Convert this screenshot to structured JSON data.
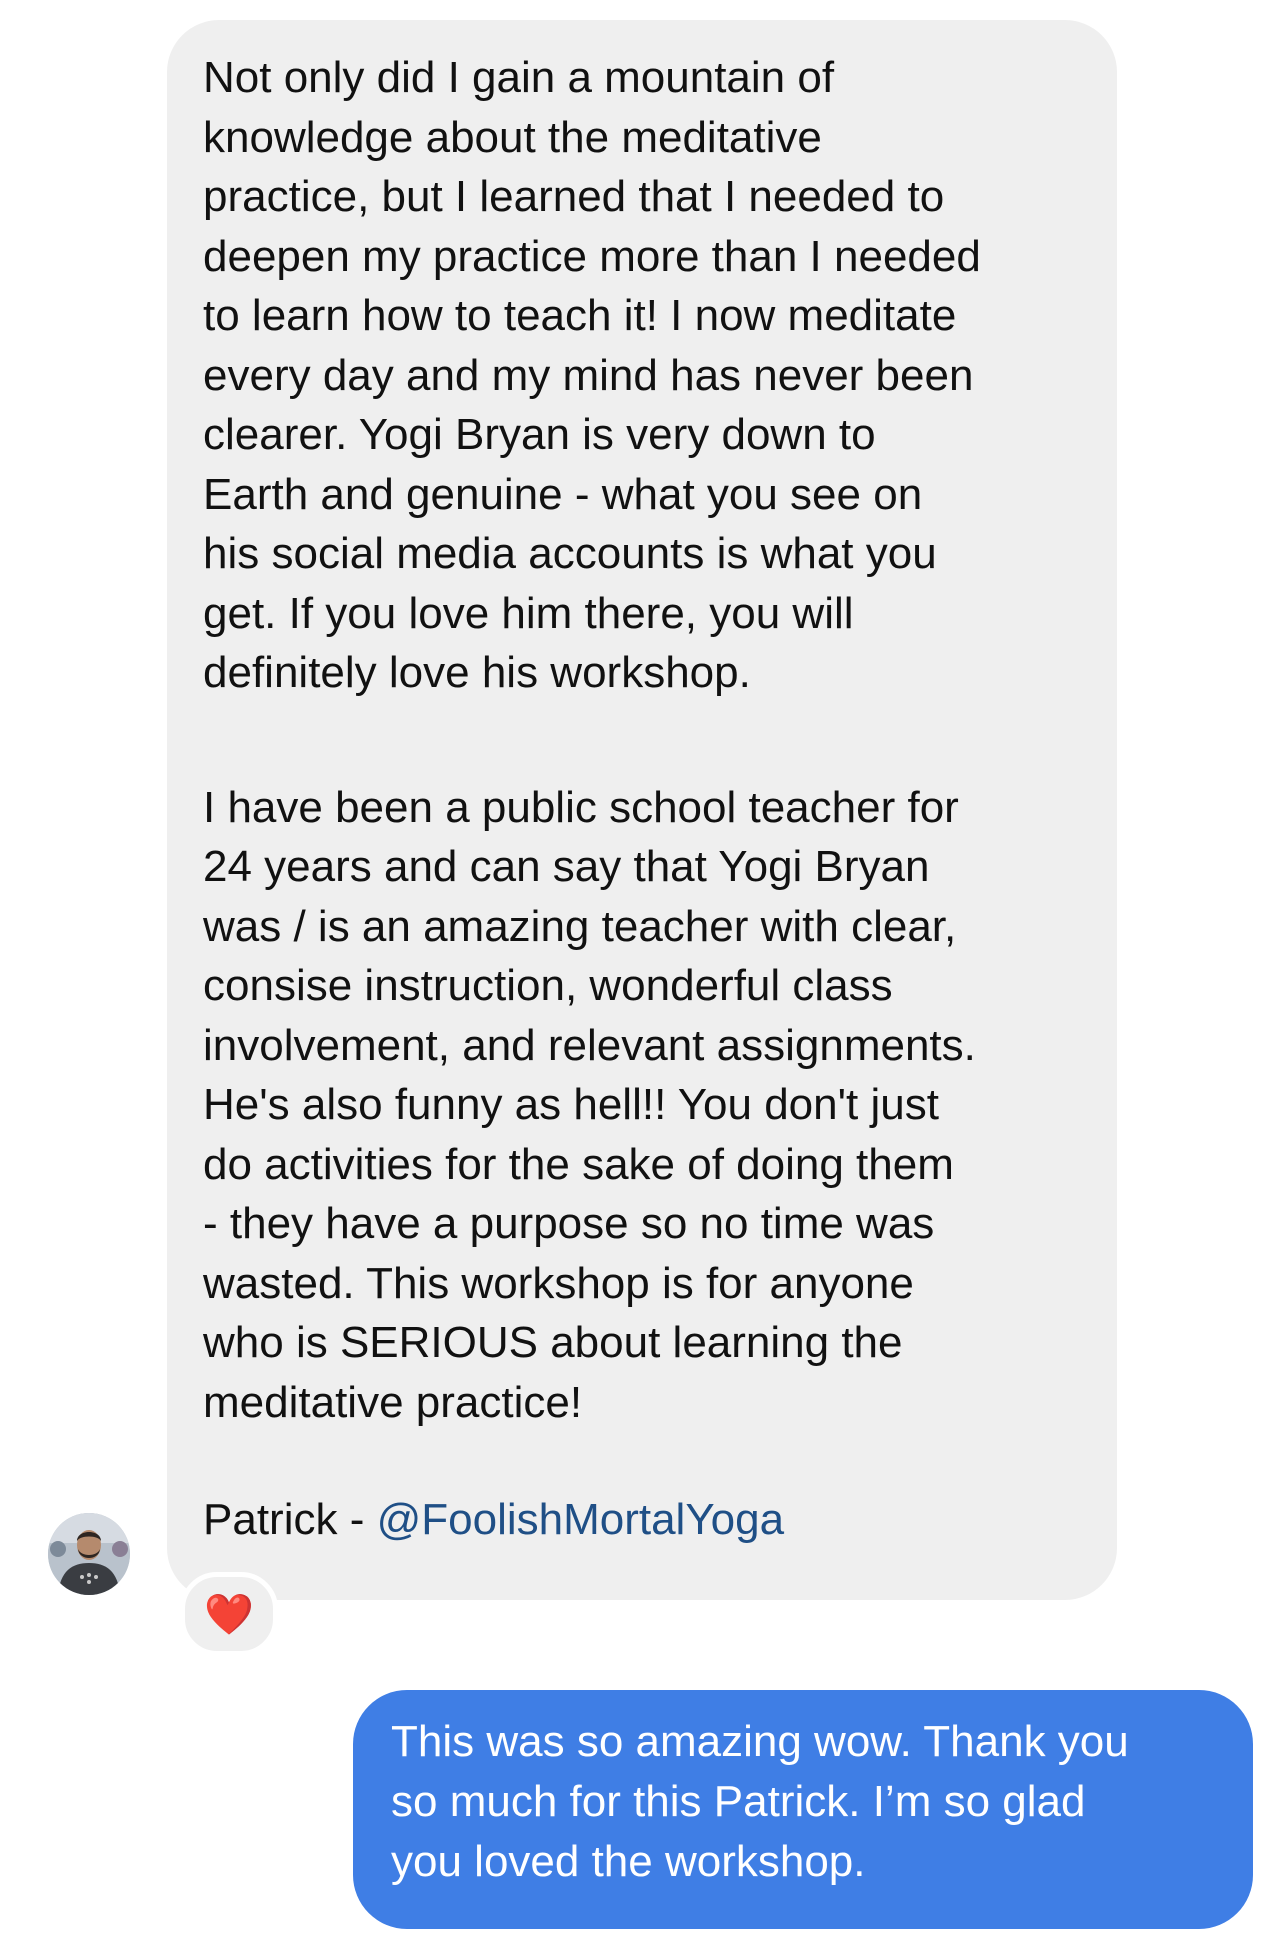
{
  "incoming_message": {
    "paragraph_1": "Not only did I gain a mountain of\nknowledge about the meditative\npractice, but I learned that I needed to\ndeepen my practice more than I needed\nto learn how to teach it!  I now meditate\nevery day and my mind has never been\nclearer.  Yogi Bryan is very down to\nEarth and genuine - what you see on\nhis social media accounts is what you\nget.  If you love him there, you will\ndefinitely love his workshop.",
    "paragraph_2": "I have been a public school teacher for\n24 years and can say that Yogi Bryan\nwas / is an amazing teacher with clear,\nconsise instruction, wonderful class\ninvolvement, and relevant assignments.\nHe's also funny as hell!!  You don't just\ndo activities for the sake of doing them\n- they have a purpose so no time was\nwasted.  This workshop is for anyone\nwho is SERIOUS about learning the\nmeditative practice!",
    "signature_name": "Patrick - ",
    "signature_handle": "@FoolishMortalYoga",
    "reaction_icon": "heart-icon",
    "reaction_glyph": "❤️",
    "bubble_color": "#efefef",
    "handle_color": "#1f4f86"
  },
  "outgoing_message": {
    "text": "This was so amazing wow.  Thank you\nso much for this Patrick.  I’m so glad\nyou loved the workshop.",
    "bubble_color": "#3f7ee5"
  },
  "avatar": {
    "icon": "avatar-photo"
  }
}
